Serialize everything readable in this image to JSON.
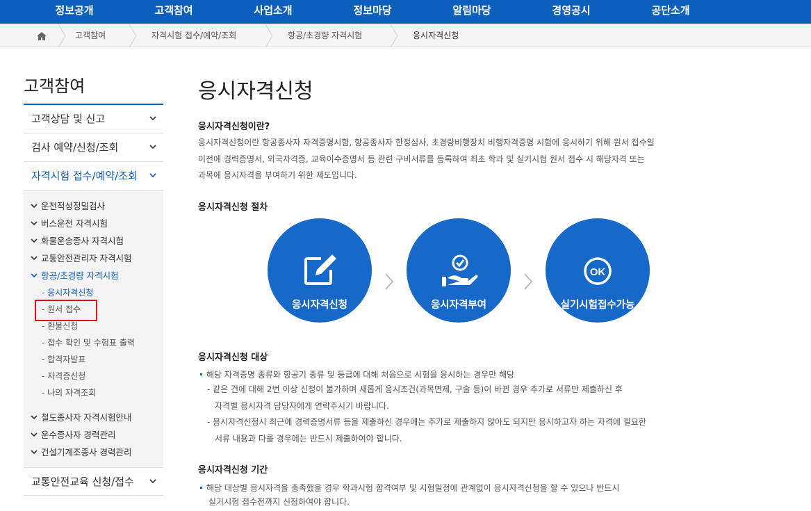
{
  "topnav": {
    "items": [
      "정보공개",
      "고객참여",
      "사업소개",
      "정보마당",
      "알림마당",
      "경영공시",
      "공단소개"
    ]
  },
  "breadcrumb": {
    "items": [
      "고객참여",
      "자격시험 접수/예약/조회",
      "항공/초경량 자격시험",
      "응시자격신청"
    ]
  },
  "sidebar": {
    "title": "고객참여",
    "menus": [
      "고객상담 및 신고",
      "검사 예약/신청/조회",
      "자격시험 접수/예약/조회"
    ],
    "sub2_top": [
      "운전적성정밀검사",
      "버스운전 자격시험",
      "화물운송종사 자격시험",
      "교통안전관리자 자격시험",
      "항공/초경량 자격시험"
    ],
    "sub3": [
      "- 응시자격신청",
      "- 원서 접수",
      "- 환불신청",
      "- 접수 확인 및 수험표 출력",
      "- 합격자발표",
      "- 자격증신청",
      "- 나의 자격조회"
    ],
    "sub2_bottom": [
      "철도종사자 자격시험안내",
      "운수종사자 경력관리",
      "건설기계조종사 경력관리"
    ],
    "last_menu": "교통안전교육 신청/접수"
  },
  "main": {
    "title": "응시자격신청",
    "sec1": {
      "heading": "응시자격신청이란?",
      "lines": [
        "응시자격신청이란 항공종사자 자격증명시험, 항공종사자 한정심사, 초경량비행장치 비행자격증명 시험에 응시하기 위해 원서 접수일",
        "이전에 경력증명서, 외국자격증, 교육이수증명서 등 관련 구비서류를 등록하여 최초 학과 및 실기시험 원서 접수 시 해당자격 또는",
        "과목에 응시자격을 부여하기 위한 제도입니다."
      ]
    },
    "sec2": {
      "heading": "응시자격신청 절차",
      "steps": [
        "응시자격신청",
        "응시자격부여",
        "실기시험접수가능"
      ],
      "ok_text": "OK"
    },
    "sec3": {
      "heading": "응시자격신청 대상",
      "bullet": "해당 자격증명 종류와 항공기 종류 및 등급에 대해 처음으로 시험을 응시하는 경우만 해당",
      "dash1": [
        "- 같은 건에 대해 2번 이상 신청이 불가하며 새롭게 응시조건(과목면제, 구술 등)이 바뀐 경우 추가로 서류만 제출하신 후",
        "자격별 응시자격 담당자에게 연락주시기 바랍니다."
      ],
      "dash2": [
        "- 응시자격신청시 최근에 경력증명서류 등을 제출하신 경우에는 추가로 제출하지 않아도 되지만 응시하고자 하는 자격에 필요한",
        "서류 내용과 다를 경우에는 반드시 제출하여야 합니다."
      ]
    },
    "sec4": {
      "heading": "응시자격신청 기간",
      "bullet": "해당 대상별 응시자격을 충족했을 경우 학과시험 합격여부 및 시험일정에 관계없이 응시자격신청을 할 수 있으나 반드시",
      "cont": "실기시험 접수전까지 신청하여야 합니다."
    }
  },
  "colors": {
    "brand_blue": "#0d5fbd",
    "circle_blue": "#1668c9",
    "highlight_red": "#e01212"
  }
}
